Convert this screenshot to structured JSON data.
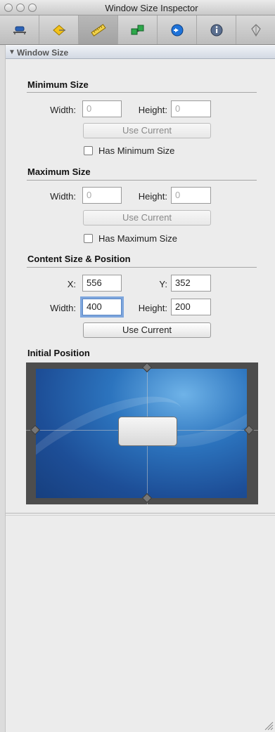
{
  "window": {
    "title": "Window Size Inspector"
  },
  "toolbar": {
    "tabs": [
      {
        "icon": "attributes-icon",
        "active": false
      },
      {
        "icon": "effects-icon",
        "active": false
      },
      {
        "icon": "size-ruler-icon",
        "active": true
      },
      {
        "icon": "connections-icon",
        "active": false
      },
      {
        "icon": "bindings-icon",
        "active": false
      },
      {
        "icon": "info-icon",
        "active": false
      },
      {
        "icon": "applescript-icon",
        "active": false
      }
    ]
  },
  "section": {
    "title": "Window Size"
  },
  "minimum": {
    "title": "Minimum Size",
    "width_label": "Width:",
    "width_value": "0",
    "height_label": "Height:",
    "height_value": "0",
    "button": "Use Current",
    "checkbox": "Has Minimum Size"
  },
  "maximum": {
    "title": "Maximum Size",
    "width_label": "Width:",
    "width_value": "0",
    "height_label": "Height:",
    "height_value": "0",
    "button": "Use Current",
    "checkbox": "Has Maximum Size"
  },
  "content": {
    "title": "Content Size & Position",
    "x_label": "X:",
    "x_value": "556",
    "y_label": "Y:",
    "y_value": "352",
    "width_label": "Width:",
    "width_value": "400",
    "height_label": "Height:",
    "height_value": "200",
    "button": "Use Current"
  },
  "initial_position": {
    "title": "Initial Position"
  }
}
